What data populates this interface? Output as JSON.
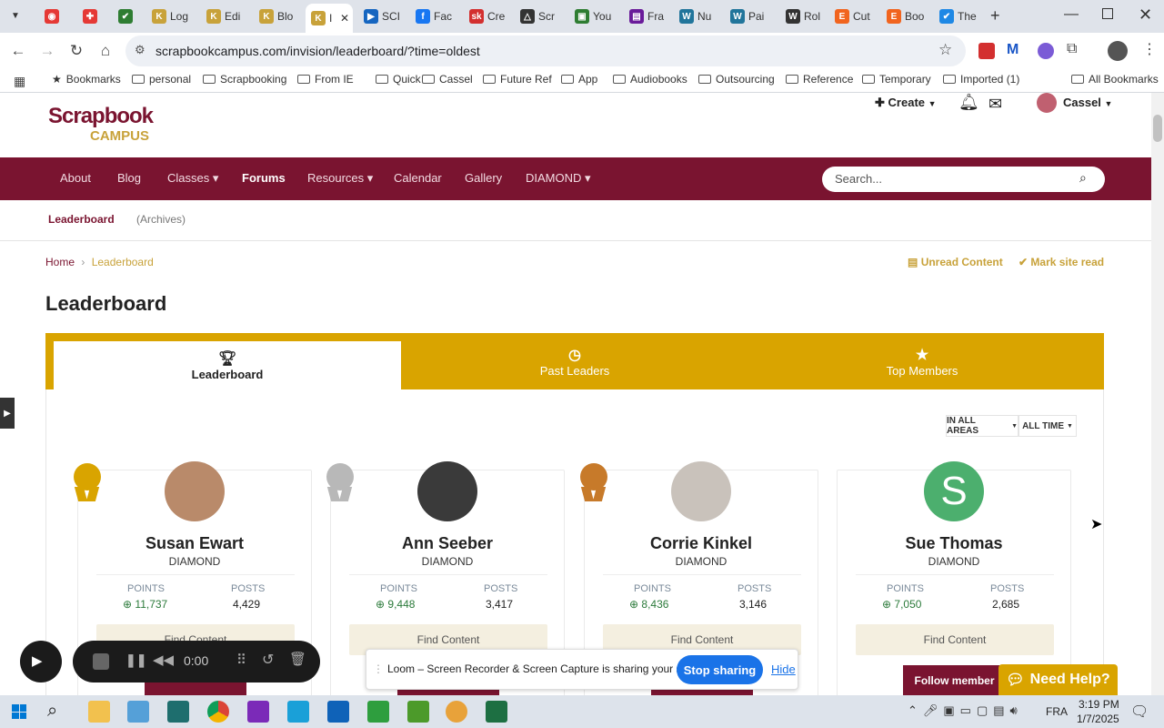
{
  "browser": {
    "tabs": [
      {
        "label": "",
        "color": "#e53935",
        "glyph": "◉"
      },
      {
        "label": "",
        "color": "#e53935",
        "glyph": "✚"
      },
      {
        "label": "",
        "color": "#2e7d32",
        "glyph": "✔"
      },
      {
        "label": "Log",
        "color": "#c8a23a",
        "glyph": "K"
      },
      {
        "label": "Edi",
        "color": "#c8a23a",
        "glyph": "K"
      },
      {
        "label": "Blo",
        "color": "#c8a23a",
        "glyph": "K"
      },
      {
        "label": "I",
        "color": "#c8a23a",
        "glyph": "K",
        "active": true
      },
      {
        "label": "SCI",
        "color": "#1565c0",
        "glyph": "▶"
      },
      {
        "label": "Fac",
        "color": "#1877f2",
        "glyph": "f"
      },
      {
        "label": "Cre",
        "color": "#d32f2f",
        "glyph": "sk"
      },
      {
        "label": "Scr",
        "color": "#333333",
        "glyph": "△"
      },
      {
        "label": "You",
        "color": "#2e7d32",
        "glyph": "▣"
      },
      {
        "label": "Fra",
        "color": "#6a1b9a",
        "glyph": "▤"
      },
      {
        "label": "Nu",
        "color": "#21759b",
        "glyph": "W"
      },
      {
        "label": "Pai",
        "color": "#21759b",
        "glyph": "W"
      },
      {
        "label": "Rol",
        "color": "#333333",
        "glyph": "W"
      },
      {
        "label": "Cut",
        "color": "#f1641e",
        "glyph": "E"
      },
      {
        "label": "Boo",
        "color": "#f1641e",
        "glyph": "E"
      },
      {
        "label": "The",
        "color": "#1e88e5",
        "glyph": "✔"
      }
    ],
    "url": "scrapbookcampus.com/invision/leaderboard/?time=oldest",
    "bookmarks": [
      "Bookmarks",
      "personal",
      "Scrapbooking",
      "From IE",
      "Quick",
      "Cassel",
      "Future Ref",
      "App",
      "Audiobooks",
      "Outsourcing",
      "Reference",
      "Temporary",
      "Imported (1)"
    ],
    "all_bookmarks": "All Bookmarks"
  },
  "site": {
    "logo_line1": "Scrapbook",
    "logo_line2": "CAMPUS",
    "create_label": "Create",
    "user_name": "Cassel",
    "nav": [
      "About",
      "Blog",
      "Classes",
      "Forums",
      "Resources",
      "Calendar",
      "Gallery",
      "DIAMOND"
    ],
    "search_placeholder": "Search...",
    "subnav": {
      "active": "Leaderboard",
      "other": "(Archives)"
    },
    "breadcrumb": {
      "home": "Home",
      "current": "Leaderboard"
    },
    "unread": "Unread Content",
    "mark_read": "Mark site read",
    "page_title": "Leaderboard",
    "tabs": [
      "Leaderboard",
      "Past Leaders",
      "Top Members"
    ],
    "filters": [
      "IN ALL AREAS",
      "ALL TIME"
    ]
  },
  "leaders": [
    {
      "name": "Susan Ewart",
      "rank": "DIAMOND",
      "points": "11,737",
      "posts": "4,429",
      "medal": "#d9a400"
    },
    {
      "name": "Ann Seeber",
      "rank": "DIAMOND",
      "points": "9,448",
      "posts": "3,417",
      "medal": "#b8b8b8"
    },
    {
      "name": "Corrie Kinkel",
      "rank": "DIAMOND",
      "points": "8,436",
      "posts": "3,146",
      "medal": "#c77a2a"
    },
    {
      "name": "Sue Thomas",
      "rank": "DIAMOND",
      "points": "7,050",
      "posts": "2,685",
      "medal": ""
    }
  ],
  "labels": {
    "points": "POINTS",
    "posts": "POSTS",
    "find": "Find Content",
    "follow": "Follow member",
    "follow_visible": "Follow member"
  },
  "loom": {
    "timer": "0:00",
    "message": "Loom – Screen Recorder & Screen Capture is sharing your screen.",
    "stop": "Stop sharing",
    "hide": "Hide"
  },
  "help": "Need Help?",
  "taskbar": {
    "lang": "FRA",
    "time": "3:19 PM",
    "date": "1/7/2025"
  }
}
